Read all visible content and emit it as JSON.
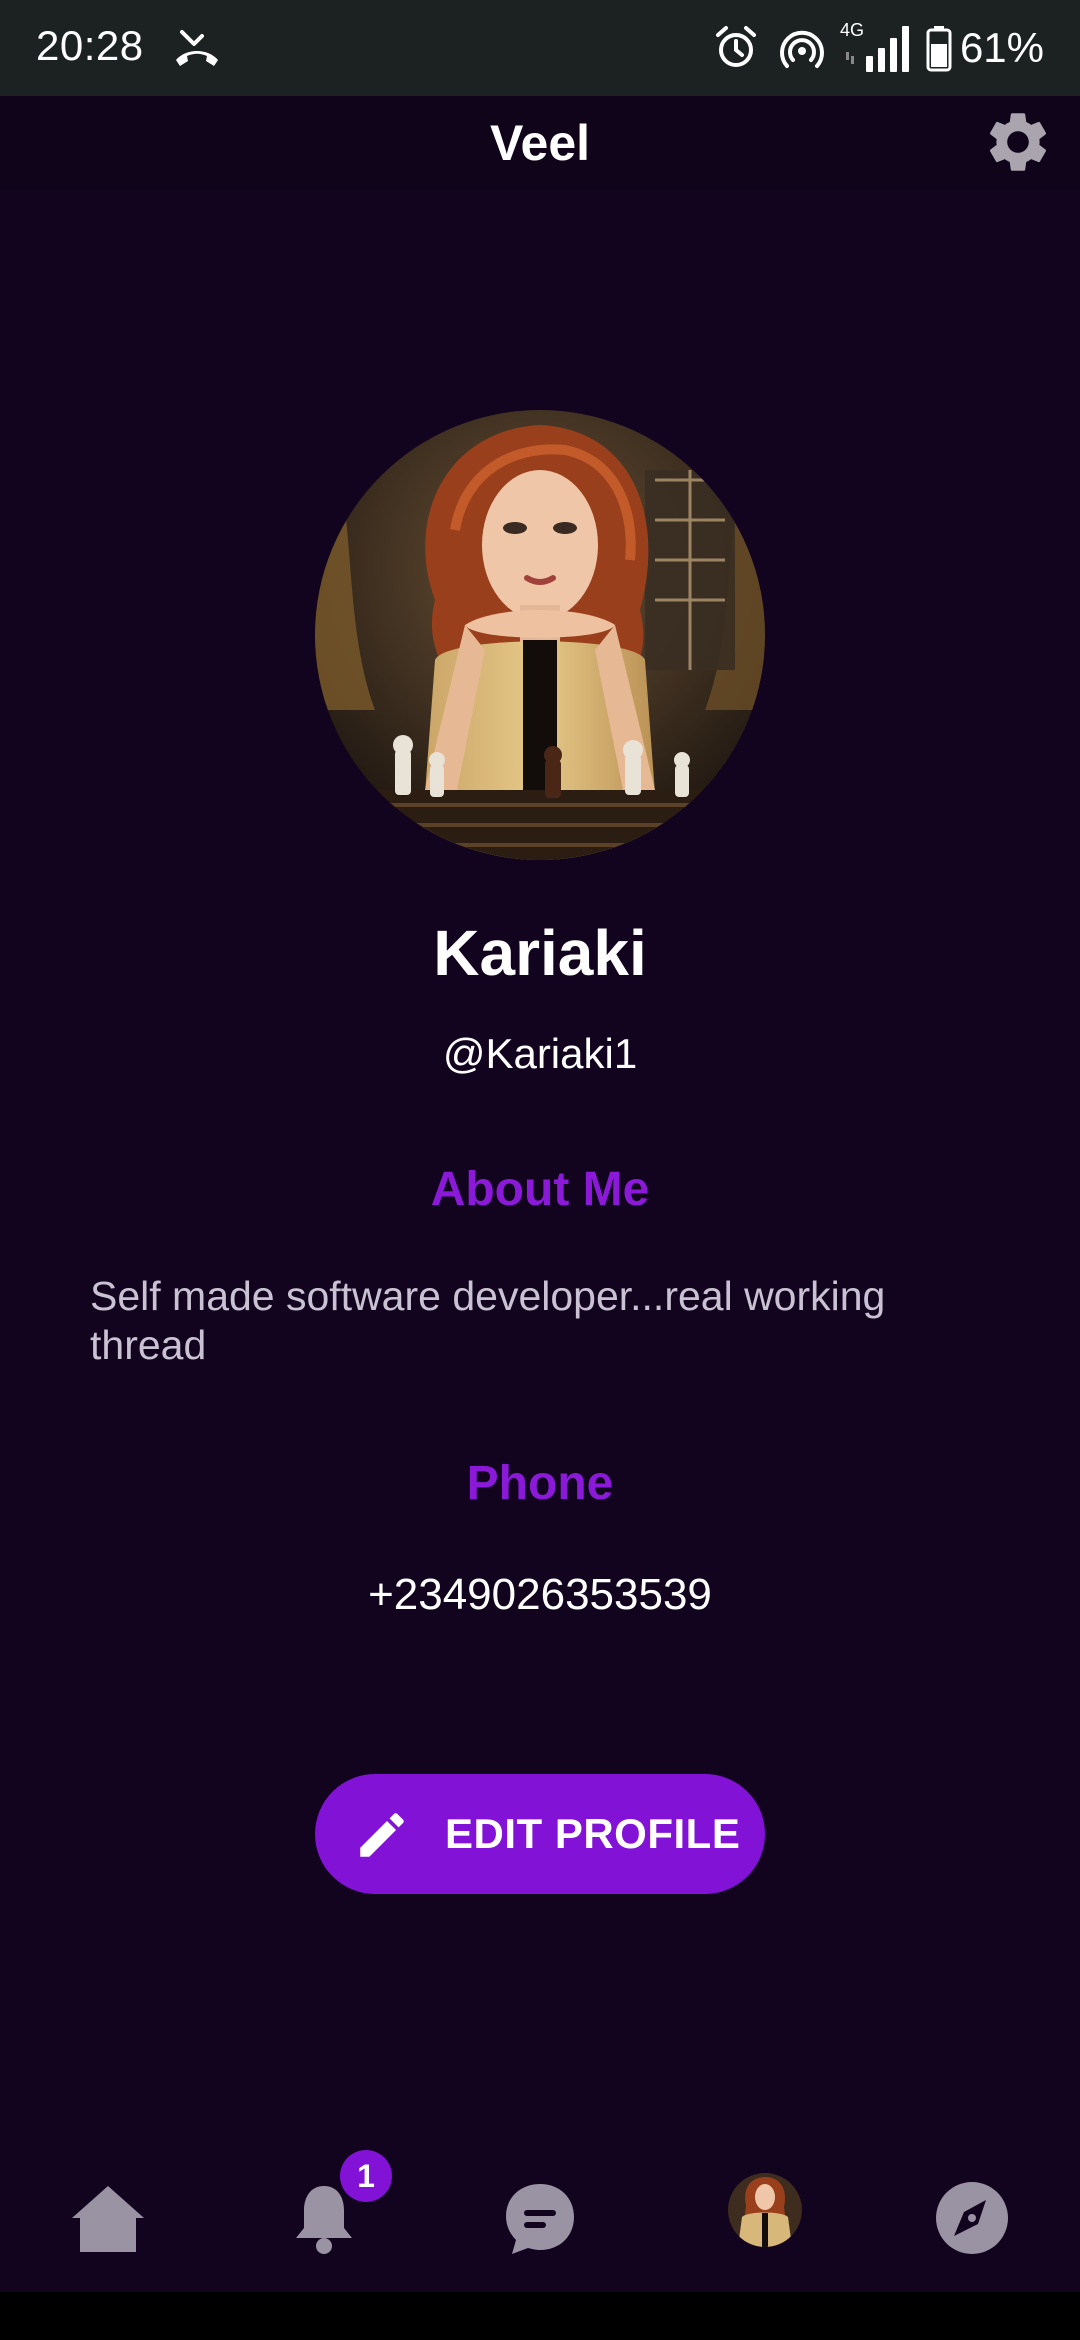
{
  "status_bar": {
    "time": "20:28",
    "network": "4G",
    "battery": "61%",
    "icons": [
      "missed-call-icon",
      "alarm-icon",
      "hotspot-icon",
      "signal-icon",
      "battery-icon"
    ]
  },
  "app_bar": {
    "title": "Veel",
    "settings_icon": "gear-icon"
  },
  "profile": {
    "name": "Kariaki",
    "handle": "@Kariaki1",
    "about_heading": "About Me",
    "about_text": "Self made software developer...real working thread",
    "phone_heading": "Phone",
    "phone": "+2349026353539"
  },
  "actions": {
    "edit_label": "EDIT PROFILE",
    "edit_icon": "pencil-icon"
  },
  "bottom_nav": {
    "items": [
      {
        "name": "home",
        "icon": "home-icon"
      },
      {
        "name": "notifications",
        "icon": "bell-icon",
        "badge": "1"
      },
      {
        "name": "chat",
        "icon": "chat-icon"
      },
      {
        "name": "profile",
        "icon": "avatar"
      },
      {
        "name": "explore",
        "icon": "compass-icon"
      }
    ]
  },
  "colors": {
    "background": "#12031f",
    "accent": "#8212d6",
    "heading": "#8a1ad8",
    "nav_icon": "#9a93a3"
  }
}
